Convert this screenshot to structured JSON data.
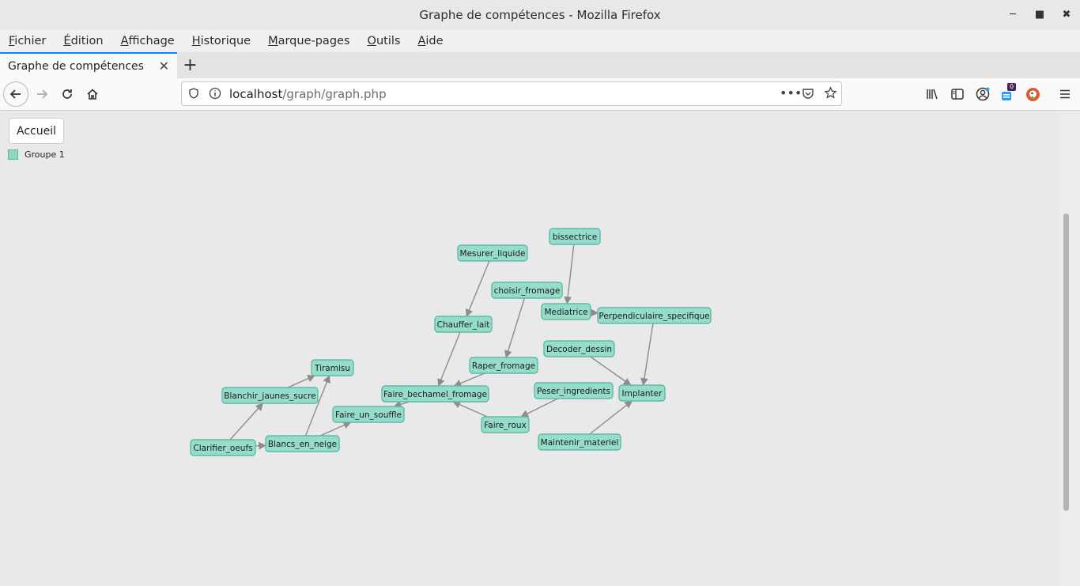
{
  "window": {
    "title": "Graphe de compétences - Mozilla Firefox"
  },
  "menubar": {
    "items": [
      {
        "label": "Fichier",
        "accesskey": "F"
      },
      {
        "label": "Édition",
        "accesskey": "É"
      },
      {
        "label": "Affichage",
        "accesskey": "A"
      },
      {
        "label": "Historique",
        "accesskey": "H"
      },
      {
        "label": "Marque-pages",
        "accesskey": "M"
      },
      {
        "label": "Outils",
        "accesskey": "O"
      },
      {
        "label": "Aide",
        "accesskey": "A"
      }
    ]
  },
  "tab": {
    "title": "Graphe de compétences"
  },
  "url": {
    "host": "localhost",
    "path": "/graph/graph.php"
  },
  "toolbar": {
    "notifications_badge": "0"
  },
  "page": {
    "home_button": "Accueil",
    "legend": [
      {
        "label": "Groupe 1",
        "color": "#8fd6c6"
      }
    ]
  },
  "graph": {
    "nodes": [
      {
        "id": "bissectrice",
        "label": "bissectrice"
      },
      {
        "id": "mesurer",
        "label": "Mesurer_liquide"
      },
      {
        "id": "choisir",
        "label": "choisir_fromage"
      },
      {
        "id": "mediatrice",
        "label": "Mediatrice"
      },
      {
        "id": "perp",
        "label": "Perpendiculaire_specifique"
      },
      {
        "id": "chauffer",
        "label": "Chauffer_lait"
      },
      {
        "id": "decoder",
        "label": "Decoder_dessin"
      },
      {
        "id": "raper",
        "label": "Raper_fromage"
      },
      {
        "id": "tiramisu",
        "label": "Tiramisu"
      },
      {
        "id": "peser",
        "label": "Peser_ingredients"
      },
      {
        "id": "blanchir",
        "label": "Blanchir_jaunes_sucre"
      },
      {
        "id": "bechamel",
        "label": "Faire_bechamel_fromage"
      },
      {
        "id": "implanter",
        "label": "Implanter"
      },
      {
        "id": "souffle",
        "label": "Faire_un_souffle"
      },
      {
        "id": "roux",
        "label": "Faire_roux"
      },
      {
        "id": "maintenir",
        "label": "Maintenir_materiel"
      },
      {
        "id": "blancs",
        "label": "Blancs_en_neige"
      },
      {
        "id": "clarifier",
        "label": "Clarifier_oeufs"
      }
    ],
    "edges": [
      [
        "bissectrice",
        "mediatrice"
      ],
      [
        "mediatrice",
        "perp"
      ],
      [
        "perp",
        "implanter"
      ],
      [
        "decoder",
        "implanter"
      ],
      [
        "maintenir",
        "implanter"
      ],
      [
        "mesurer",
        "chauffer"
      ],
      [
        "choisir",
        "raper"
      ],
      [
        "chauffer",
        "bechamel"
      ],
      [
        "raper",
        "bechamel"
      ],
      [
        "roux",
        "bechamel"
      ],
      [
        "peser",
        "roux"
      ],
      [
        "bechamel",
        "souffle"
      ],
      [
        "blancs",
        "souffle"
      ],
      [
        "clarifier",
        "blancs"
      ],
      [
        "clarifier",
        "blanchir"
      ],
      [
        "blanchir",
        "tiramisu"
      ],
      [
        "blancs",
        "tiramisu"
      ]
    ]
  }
}
